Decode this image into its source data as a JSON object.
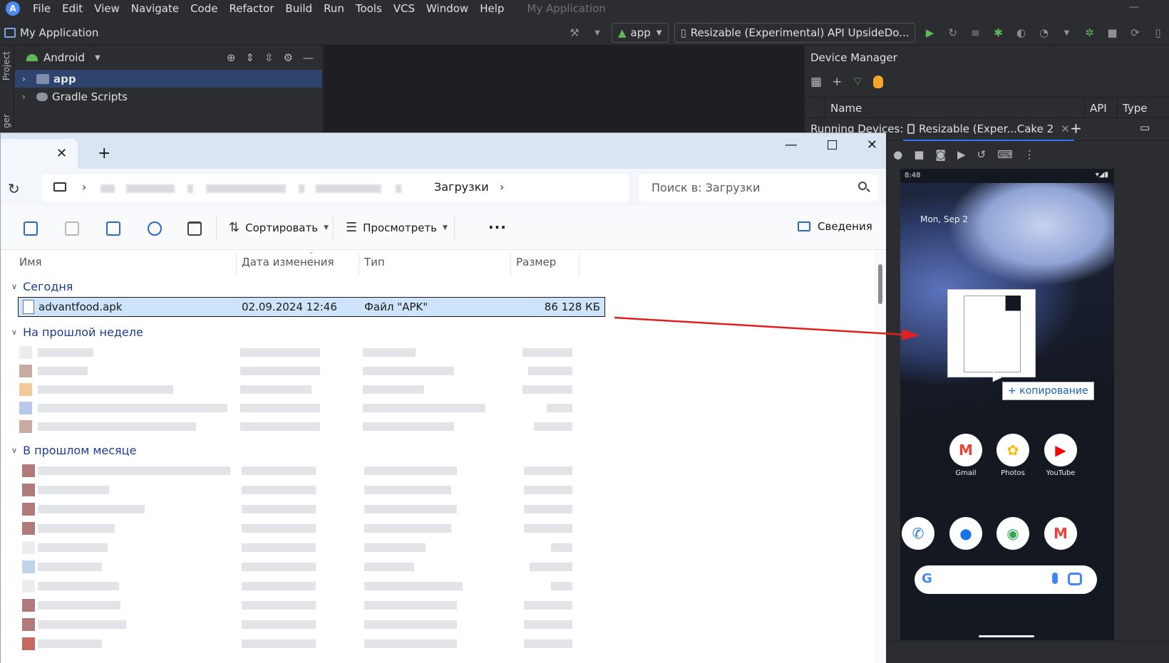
{
  "studio": {
    "menu": [
      "File",
      "Edit",
      "View",
      "Navigate",
      "Code",
      "Refactor",
      "Build",
      "Run",
      "Tools",
      "VCS",
      "Window",
      "Help"
    ],
    "window_title": "My Application",
    "project_name": "My Application",
    "run_config": "app",
    "device_selector": "Resizable (Experimental) API UpsideDo..."
  },
  "project_panel": {
    "view_mode": "Android",
    "tree": [
      {
        "label": "app",
        "selected": true
      },
      {
        "label": "Gradle Scripts",
        "selected": false
      }
    ],
    "stripe_label": "Project",
    "stripe_label2": "ger"
  },
  "device_manager": {
    "title": "Device Manager",
    "columns": [
      "Name",
      "API",
      "Type"
    ],
    "running_label": "Running Devices:",
    "running_tab": "Resizable (Exper...Cake 2"
  },
  "phone": {
    "time": "8:48",
    "date": "Mon, Sep 2",
    "copy_tooltip": "+ копирование",
    "apps_row1": [
      {
        "label": "Gmail",
        "icon": "gmail-icon",
        "glyph": "M",
        "color": "#ea4335"
      },
      {
        "label": "Photos",
        "icon": "photos-icon",
        "glyph": "✿",
        "color": "#fbbc04"
      },
      {
        "label": "YouTube",
        "icon": "youtube-icon",
        "glyph": "▶",
        "color": "#ff0000"
      }
    ],
    "dock": [
      {
        "icon": "phone-icon",
        "glyph": "✆",
        "color": "#1a73e8"
      },
      {
        "icon": "messages-icon",
        "glyph": "●",
        "color": "#1a73e8"
      },
      {
        "icon": "chrome-icon",
        "glyph": "◉",
        "color": "#34a853"
      },
      {
        "icon": "gmail-icon",
        "glyph": "M",
        "color": "#ea4335"
      }
    ],
    "search_logo": "G"
  },
  "explorer": {
    "current_folder": "Загрузки",
    "search_placeholder": "Поиск в: Загрузки",
    "commands": {
      "sort": "Сортировать",
      "view": "Просмотреть",
      "details": "Сведения"
    },
    "columns": [
      "Имя",
      "Дата изменения",
      "Тип",
      "Размер"
    ],
    "groups": {
      "today": "Сегодня",
      "last_week": "На прошлой неделе",
      "last_month": "В прошлом месяце"
    },
    "selected_file": {
      "name": "advantfood.apk",
      "modified": "02.09.2024 12:46",
      "type": "Файл \"APK\"",
      "size": "86 128 КБ"
    }
  },
  "colors": {
    "ide_bg": "#2b2d30",
    "selection": "#2e436e",
    "explorer_group": "#1c3d8f",
    "selected_row": "#cde4fa",
    "arrow": "#e02020"
  }
}
